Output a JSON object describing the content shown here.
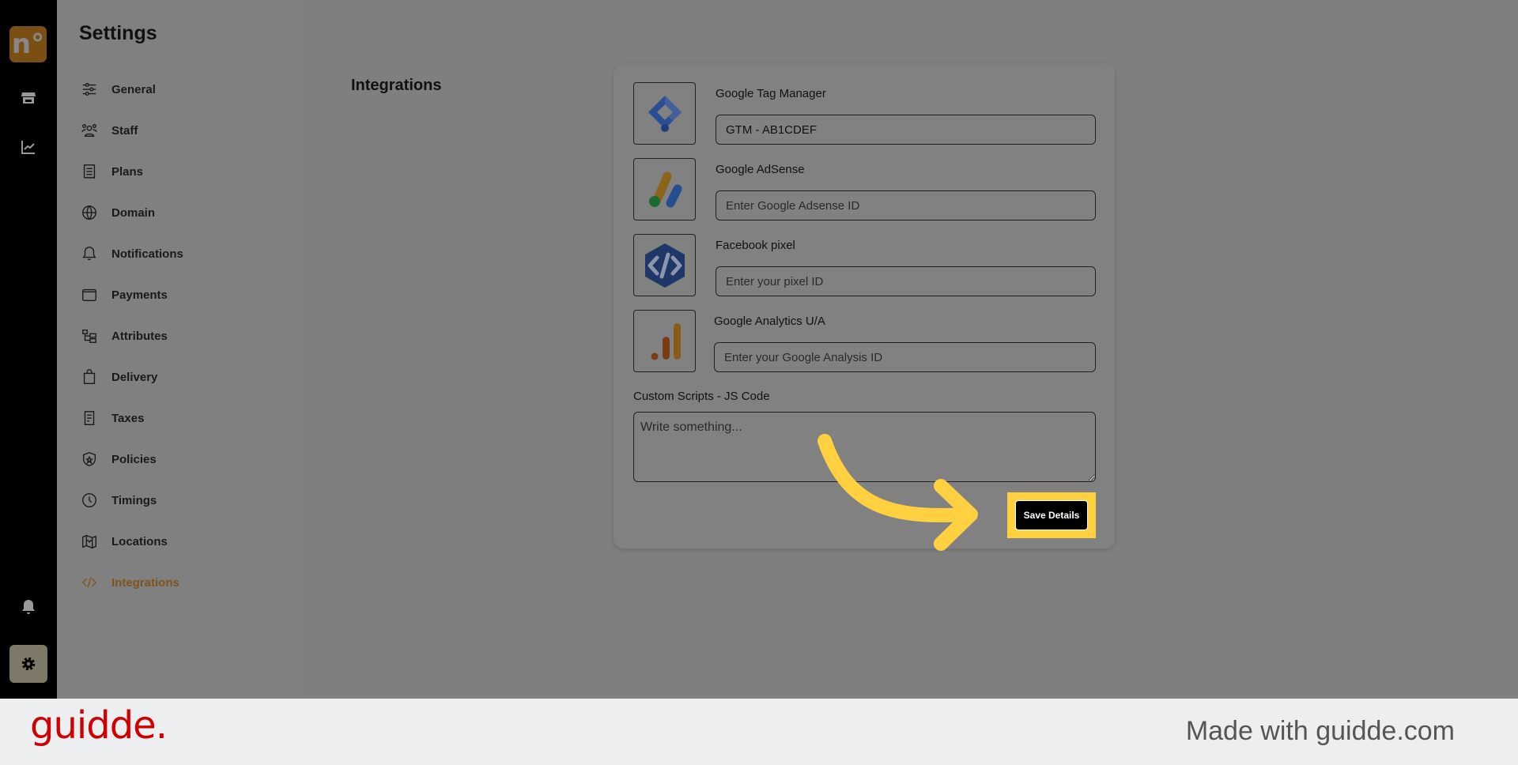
{
  "rail": {
    "logo": "n°",
    "icons": [
      "store-icon",
      "chart-icon",
      "bell-icon",
      "gear-icon"
    ]
  },
  "settings": {
    "title": "Settings",
    "items": [
      {
        "label": "General",
        "icon": "sliders-icon"
      },
      {
        "label": "Staff",
        "icon": "users-icon"
      },
      {
        "label": "Plans",
        "icon": "receipt-icon"
      },
      {
        "label": "Domain",
        "icon": "globe-icon"
      },
      {
        "label": "Notifications",
        "icon": "bell-icon"
      },
      {
        "label": "Payments",
        "icon": "wallet-icon"
      },
      {
        "label": "Attributes",
        "icon": "hierarchy-icon"
      },
      {
        "label": "Delivery",
        "icon": "bag-icon"
      },
      {
        "label": "Taxes",
        "icon": "tax-icon"
      },
      {
        "label": "Policies",
        "icon": "shield-icon"
      },
      {
        "label": "Timings",
        "icon": "clock-icon"
      },
      {
        "label": "Locations",
        "icon": "map-icon"
      },
      {
        "label": "Integrations",
        "icon": "code-icon",
        "active": true
      }
    ]
  },
  "main": {
    "title": "Integrations",
    "integrations": [
      {
        "label": "Google Tag Manager",
        "value": "GTM - AB1CDEF",
        "placeholder": ""
      },
      {
        "label": "Google AdSense",
        "value": "",
        "placeholder": "Enter Google Adsense ID"
      },
      {
        "label": "Facebook pixel",
        "value": "",
        "placeholder": "Enter your pixel ID"
      },
      {
        "label": "Google Analytics U/A",
        "value": "",
        "placeholder": "Enter your Google Analysis ID"
      }
    ],
    "custom_scripts": {
      "label": "Custom Scripts - JS Code",
      "placeholder": "Write something..."
    },
    "save_label": "Save Details"
  },
  "colors": {
    "accent": "#7d5320",
    "highlight": "#ffd140",
    "brand": "#d00000"
  },
  "footer": {
    "brand": "guidde.",
    "made_with": "Made with guidde.com"
  }
}
